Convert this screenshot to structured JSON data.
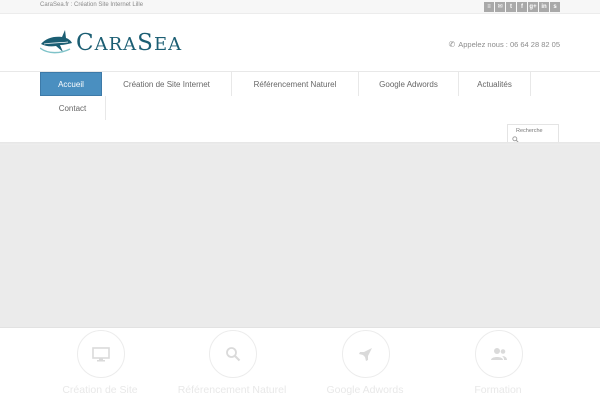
{
  "topbar": {
    "text": "CaraSea.fr : Création Site Internet Lille",
    "social": [
      "rss-icon",
      "mail-icon",
      "twitter-icon",
      "facebook-icon",
      "google-plus-icon",
      "linkedin-icon",
      "skype-icon"
    ],
    "social_glyphs": [
      "≡",
      "✉",
      "t",
      "f",
      "g+",
      "in",
      "s"
    ]
  },
  "header": {
    "logo_text_first": "C",
    "logo_text_mid": "ARA",
    "logo_text_s": "S",
    "logo_text_end": "EA",
    "phone": "Appelez nous : 06 64 28 82 05"
  },
  "nav": {
    "items": [
      {
        "label": "Accueil",
        "active": true
      },
      {
        "label": "Création de Site Internet"
      },
      {
        "label": "Référencement Naturel"
      },
      {
        "label": "Google Adwords"
      },
      {
        "label": "Actualités"
      },
      {
        "label": "Contact"
      }
    ]
  },
  "search": {
    "label": "Recherche"
  },
  "features": [
    {
      "label": "Création de Site",
      "icon": "monitor-icon"
    },
    {
      "label": "Référencement Naturel",
      "icon": "search-icon"
    },
    {
      "label": "Google Adwords",
      "icon": "rocket-icon"
    },
    {
      "label": "Formation",
      "icon": "users-icon"
    }
  ],
  "colors": {
    "brand": "#1b5e73",
    "nav_active": "#4a8fc0"
  }
}
